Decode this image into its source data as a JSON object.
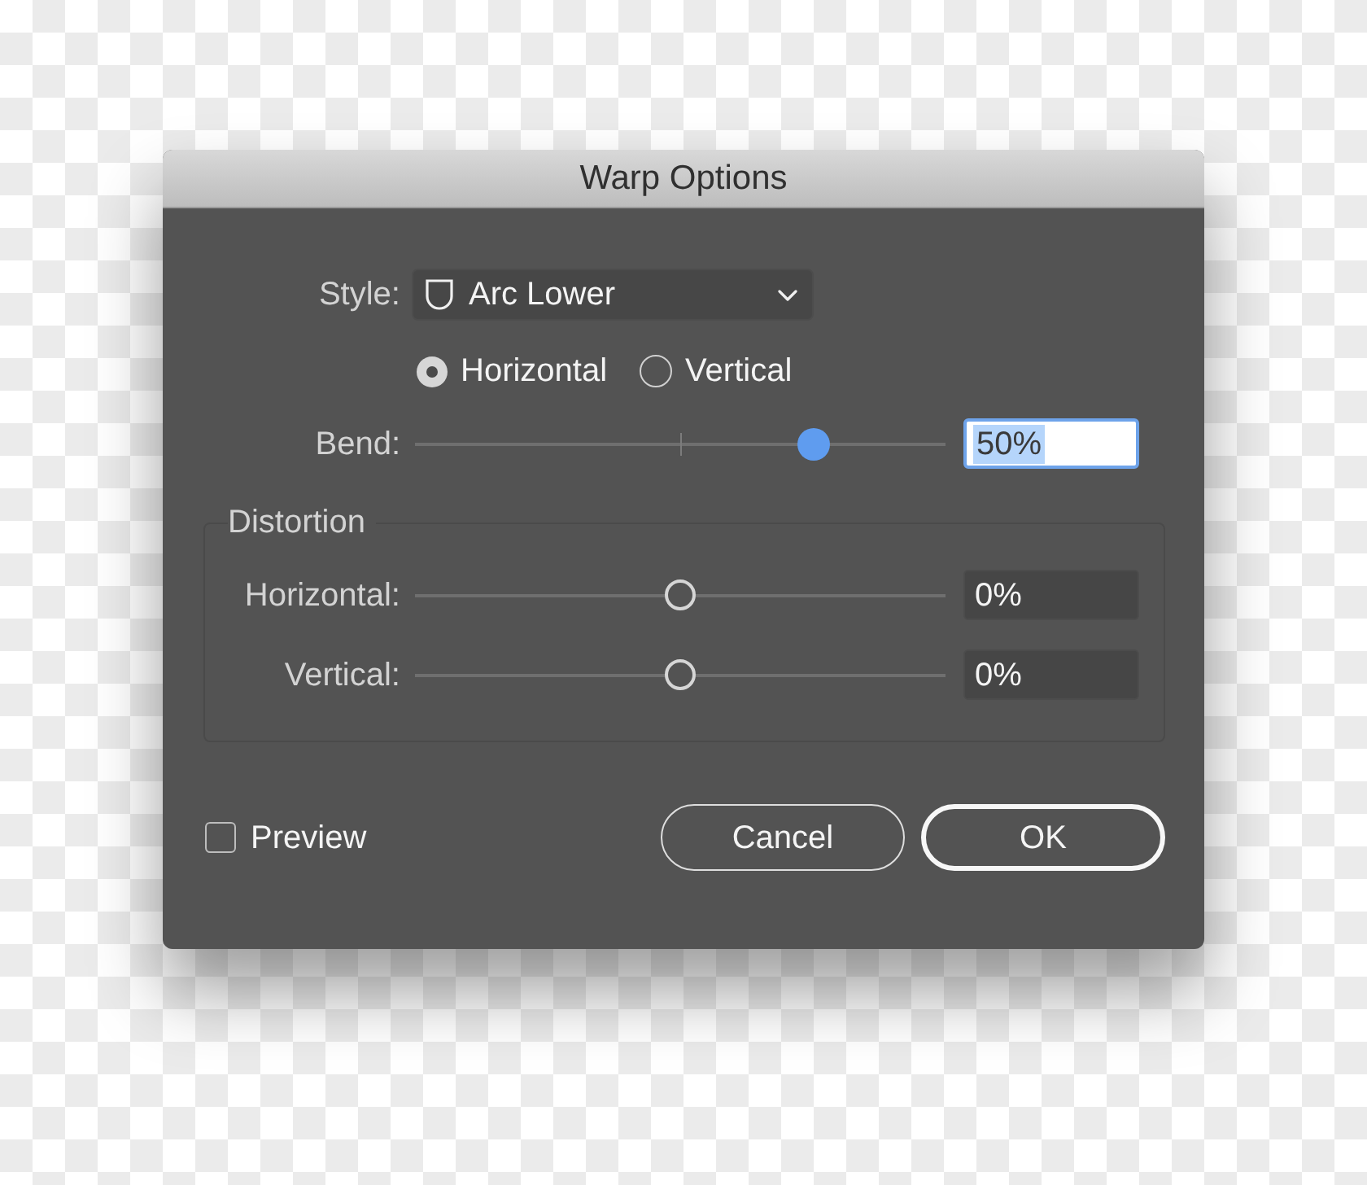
{
  "window": {
    "title": "Warp Options"
  },
  "style": {
    "label": "Style:",
    "value": "Arc Lower"
  },
  "orientation": [
    {
      "label": "Horizontal",
      "selected": true
    },
    {
      "label": "Vertical",
      "selected": false
    }
  ],
  "bend": {
    "label": "Bend:",
    "level": 0.75,
    "value": "50%",
    "focused": true
  },
  "distortion": {
    "title": "Distortion",
    "sliders": [
      {
        "label": "Horizontal:",
        "level": 0.5,
        "value": "0%",
        "focused": false
      },
      {
        "label": "Vertical:",
        "level": 0.5,
        "value": "0%",
        "focused": false
      }
    ]
  },
  "preview": {
    "label": "Preview",
    "checked": false
  },
  "buttons": [
    {
      "label": "Cancel",
      "default": false
    },
    {
      "label": "OK",
      "default": true
    }
  ]
}
